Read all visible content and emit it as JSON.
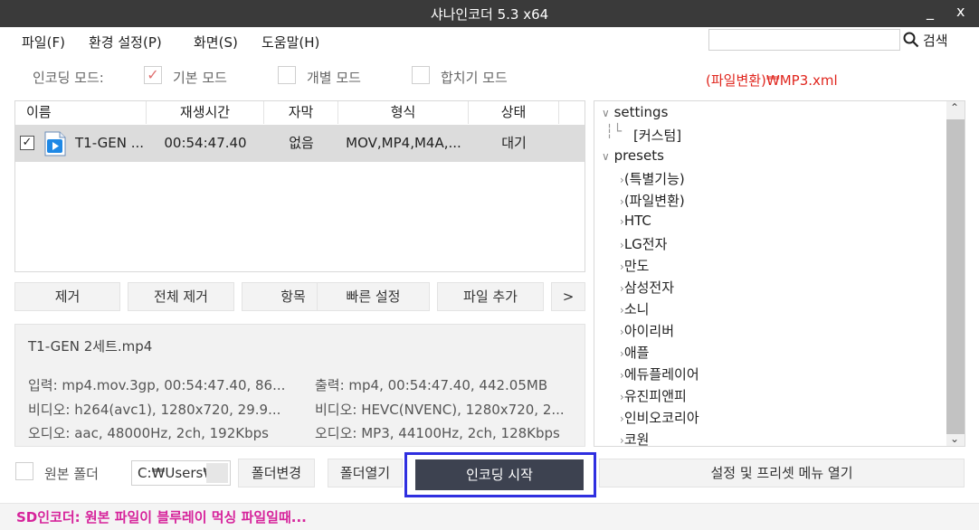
{
  "window": {
    "title": "샤나인코더  5.3  x64",
    "minimize": "_",
    "close": "x"
  },
  "menu": {
    "items": [
      "파일(F)",
      "환경 설정(P)",
      "화면(S)",
      "도움말(H)"
    ]
  },
  "search": {
    "value": "",
    "button": "검색",
    "icon": "search-icon"
  },
  "modes": {
    "label": "인코딩 모드:",
    "basic": "기본 모드",
    "basic_checked": true,
    "individual": "개별 모드",
    "merge": "합치기 모드"
  },
  "preset_path": "(파일변환)₩MP3.xml",
  "file_list": {
    "columns": [
      "이름",
      "재생시간",
      "자막",
      "형식",
      "상태"
    ],
    "rows": [
      {
        "checked": true,
        "name": "T1-GEN ...",
        "duration": "00:54:47.40",
        "subtitle": "없음",
        "format": "MOV,MP4,M4A,...",
        "status": "대기"
      }
    ]
  },
  "actions": {
    "remove": "제거",
    "remove_all": "전체 제거",
    "item": "항목",
    "quick_settings": "빠른 설정",
    "add_file": "파일 추가",
    "more": ">"
  },
  "info": {
    "filename": "T1-GEN 2세트.mp4",
    "input": "입력: mp4.mov.3gp, 00:54:47.40, 86...",
    "output": "출력: mp4, 00:54:47.40, 442.05MB",
    "video_in": "비디오: h264(avc1), 1280x720, 29.9...",
    "video_out": "비디오: HEVC(NVENC), 1280x720, 2...",
    "audio_in": "오디오: aac, 48000Hz, 2ch, 192Kbps",
    "audio_out": "오디오: MP3, 44100Hz, 2ch, 128Kbps"
  },
  "tree": {
    "settings": "settings",
    "custom": "[커스텀]",
    "presets": "presets",
    "items": [
      "(특별기능)",
      "(파일변환)",
      "HTC",
      "LG전자",
      "만도",
      "삼성전자",
      "소니",
      "아이리버",
      "애플",
      "에듀플레이어",
      "유진피앤피",
      "인비오코리아",
      "코원"
    ]
  },
  "bottom": {
    "source_folder": "원본 폴더",
    "folder_path": "C:₩Users₩",
    "change_folder": "폴더변경",
    "open_folder": "폴더열기",
    "encode": "인코딩 시작",
    "open_settings": "설정 및 프리셋 메뉴 열기"
  },
  "status": "SD인코더: 원본 파일이 블루레이 먹싱 파일일때...",
  "colors": {
    "accent": "#e0261e",
    "status": "#d6239b",
    "encode_button": "#3d4250",
    "highlight_border": "#2f2fe0"
  }
}
